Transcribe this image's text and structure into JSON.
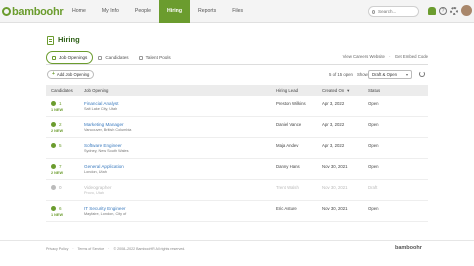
{
  "brand": {
    "logo_text": "bamboohr"
  },
  "nav": {
    "items": [
      {
        "label": "Home",
        "active": false
      },
      {
        "label": "My Info",
        "active": false
      },
      {
        "label": "People",
        "active": false
      },
      {
        "label": "Hiring",
        "active": true
      },
      {
        "label": "Reports",
        "active": false
      },
      {
        "label": "Files",
        "active": false
      }
    ]
  },
  "search": {
    "placeholder": "Search..."
  },
  "help": {
    "glyph": "?"
  },
  "page": {
    "title": "Hiring"
  },
  "tabs": [
    {
      "label": "Job Openings",
      "active": true
    },
    {
      "label": "Candidates",
      "active": false
    },
    {
      "label": "Talent Pools",
      "active": false
    }
  ],
  "tab_links": {
    "careers": "View Careers Website",
    "separator": "·",
    "embed": "Get Embed Code"
  },
  "toolbar": {
    "add_label": "Add Job Opening",
    "add_glyph": "+",
    "count_text": "5 of 15 open",
    "show_label": "Show",
    "filter_value": "Draft & Open",
    "caret": "▾"
  },
  "table": {
    "headers": [
      "Candidates",
      "Job Opening",
      "Hiring Lead",
      "Created On",
      "Status"
    ],
    "sort_glyph": "▼",
    "rows": [
      {
        "count": "1",
        "badge": "1 NEW",
        "title": "Financial Analyst",
        "location": "Salt Lake City, Utah",
        "lead": "Preston Wilkins",
        "created": "Apr 3, 2022",
        "status": "Open",
        "draft": false
      },
      {
        "count": "2",
        "badge": "2 NEW",
        "title": "Marketing Manager",
        "location": "Vancouver, British Columbia",
        "lead": "Daniel Vance",
        "created": "Apr 3, 2022",
        "status": "Open",
        "draft": false
      },
      {
        "count": "5",
        "badge": "",
        "title": "Software Engineer",
        "location": "Sydney, New South Wales",
        "lead": "Maja Andev",
        "created": "Apr 3, 2022",
        "status": "Open",
        "draft": false
      },
      {
        "count": "7",
        "badge": "2 NEW",
        "title": "General Application",
        "location": "London, Utah",
        "lead": "Danny Hans",
        "created": "Nov 30, 2021",
        "status": "Open",
        "draft": false
      },
      {
        "count": "0",
        "badge": "",
        "title": "Videographer",
        "location": "Provo, Utah",
        "lead": "Trent Walsh",
        "created": "Nov 30, 2021",
        "status": "Draft",
        "draft": true
      },
      {
        "count": "6",
        "badge": "1 NEW",
        "title": "IT Security Engineer",
        "location": "Mayfaire, London, City of",
        "lead": "Eric Asture",
        "created": "Nov 30, 2021",
        "status": "Open",
        "draft": false
      }
    ]
  },
  "footer": {
    "links": [
      "Privacy Policy",
      "·",
      "Terms of Service",
      "·",
      "© 2008–2022 BambooHR All rights reserved."
    ],
    "logo_text": "bamboohr"
  },
  "colors": {
    "brand_green": "#6b9c2e",
    "link_blue": "#3b7bbf",
    "title_green": "#2d5f15"
  }
}
